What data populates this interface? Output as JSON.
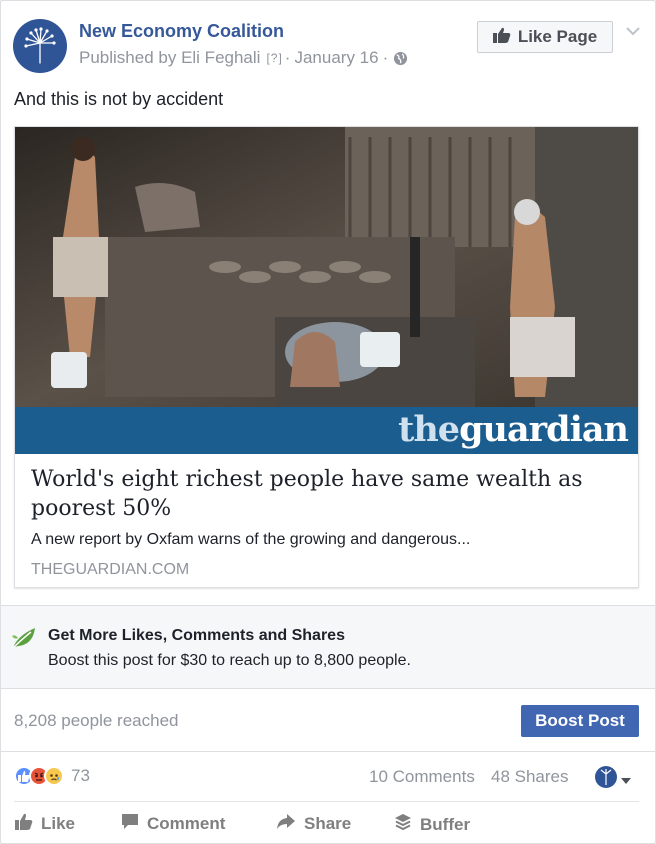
{
  "post": {
    "page_name": "New Economy Coalition",
    "published_by": "Published by Eli Feghali",
    "help_marker": "[?]",
    "separator": "·",
    "date": "January 16",
    "like_page_label": "Like Page",
    "text": "And this is not by accident"
  },
  "link_preview": {
    "logo_the": "the",
    "logo_guardian": "guardian",
    "title": "World's eight richest people have same wealth as poorest 50%",
    "description": "A new report by Oxfam warns of the growing and dangerous...",
    "domain": "THEGUARDIAN.COM"
  },
  "promo": {
    "title": "Get More Likes, Comments and Shares",
    "subtitle": "Boost this post for $30 to reach up to 8,800 people."
  },
  "reach": {
    "text": "8,208 people reached",
    "boost_label": "Boost Post"
  },
  "engagement": {
    "reaction_count": "73",
    "comments": "10 Comments",
    "shares": "48 Shares"
  },
  "actions": {
    "like": "Like",
    "comment": "Comment",
    "share": "Share",
    "buffer": "Buffer"
  },
  "colors": {
    "link_blue": "#365899",
    "boost_blue": "#4267b2",
    "muted_gray": "#90949c",
    "guardian_blue": "#1c5d8f"
  },
  "icons": {
    "avatar": "dandelion-logo",
    "globe": "globe-icon",
    "like_page": "thumbs-up-icon",
    "menu": "chevron-down-icon",
    "promo": "leaf-icon",
    "reactions": [
      "like-reaction-icon",
      "angry-reaction-icon",
      "sad-reaction-icon"
    ]
  }
}
